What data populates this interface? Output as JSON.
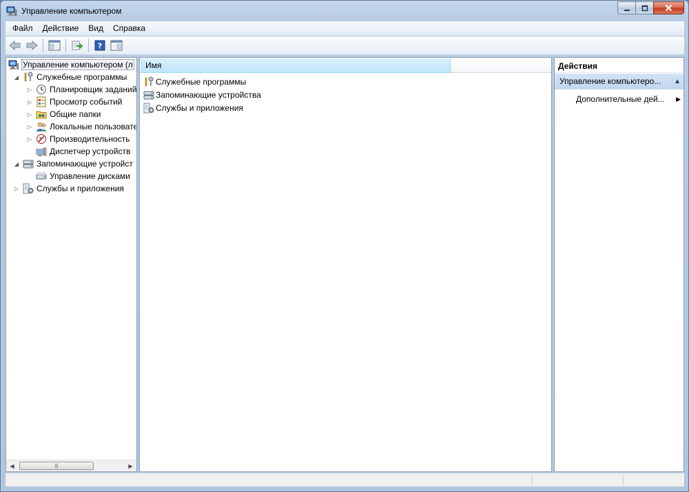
{
  "window": {
    "title": "Управление компьютером"
  },
  "menu": {
    "items": [
      "Файл",
      "Действие",
      "Вид",
      "Справка"
    ]
  },
  "toolbar": {
    "icons": [
      "back-arrow-icon",
      "forward-arrow-icon",
      "show-hide-tree-icon",
      "export-list-icon",
      "help-icon",
      "show-hide-action-pane-icon"
    ]
  },
  "tree": {
    "root": "Управление компьютером (л",
    "utilities": "Служебные программы",
    "task_scheduler": "Планировщик заданий",
    "event_viewer": "Просмотр событий",
    "shared_folders": "Общие папки",
    "local_users": "Локальные пользовате",
    "performance": "Производительность",
    "device_manager": "Диспетчер устройств",
    "storage": "Запоминающие устройст",
    "disk_management": "Управление дисками",
    "services_apps": "Службы и приложения"
  },
  "center": {
    "column_name": "Имя",
    "items": [
      "Служебные программы",
      "Запоминающие устройства",
      "Службы и приложения"
    ]
  },
  "actions": {
    "header": "Действия",
    "group": "Управление компьютеро...",
    "more_actions": "Дополнительные дей..."
  }
}
